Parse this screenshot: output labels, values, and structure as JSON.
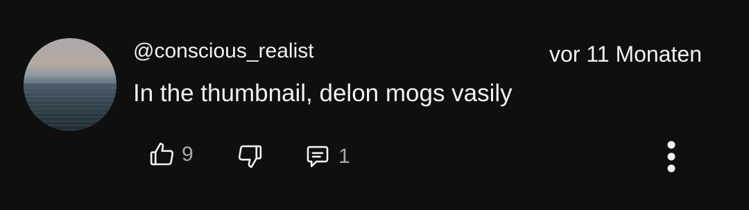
{
  "comment": {
    "author": "@conscious_realist",
    "timestamp": "vor 11 Monaten",
    "text": "In the thumbnail, delon mogs vasily",
    "like_count": "9",
    "reply_count": "1"
  },
  "icons": {
    "like": "thumbs-up-icon",
    "dislike": "thumbs-down-icon",
    "reply": "comment-icon",
    "more": "more-vertical-icon"
  },
  "colors": {
    "background": "#0f0f0f",
    "text_primary": "#f1f1f1",
    "text_secondary": "#aaaaaa"
  }
}
